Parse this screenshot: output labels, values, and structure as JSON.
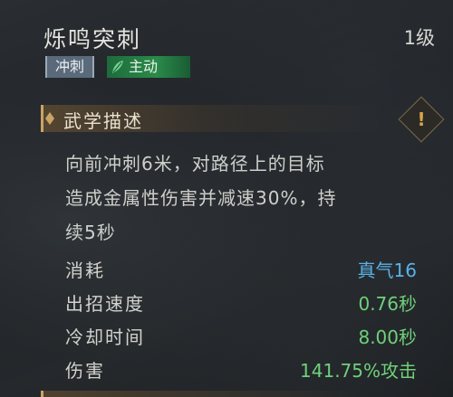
{
  "skill": {
    "name": "烁鸣突刺",
    "level": "1级",
    "tags": [
      "冲刺",
      "主动"
    ]
  },
  "section": {
    "title": "武学描述",
    "info_glyph": "!"
  },
  "description": [
    "向前冲刺6米，对路径上的目标",
    "造成金属性伤害并减速30%，持",
    "续5秒"
  ],
  "stats": [
    {
      "label": "消耗",
      "value": "真气16",
      "color": "#5ab2e8"
    },
    {
      "label": "出招速度",
      "value": "0.76秒",
      "color": "#6fd07a"
    },
    {
      "label": "冷却时间",
      "value": "8.00秒",
      "color": "#6fd07a"
    },
    {
      "label": "伤害",
      "value": "141.75%攻击",
      "color": "#6fd07a"
    }
  ],
  "icons": {
    "tag_active": "leaf-icon",
    "section": "diamond-ornament-icon",
    "info": "exclamation-icon"
  }
}
